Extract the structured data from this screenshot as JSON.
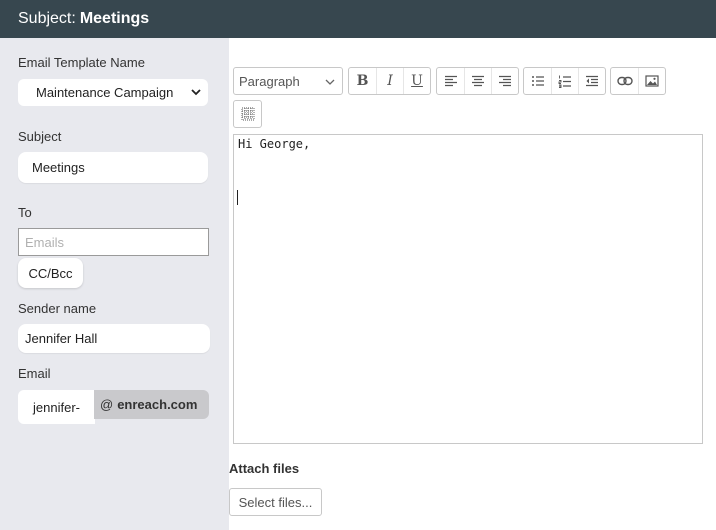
{
  "header": {
    "prefix": "Subject:",
    "subject": "Meetings"
  },
  "sidebar": {
    "template_label": "Email Template Name",
    "template_value": "Maintenance Campaign",
    "subject_label": "Subject",
    "subject_value": "Meetings",
    "to_label": "To",
    "to_placeholder": "Emails",
    "ccbcc_label": "CC/Bcc",
    "sender_label": "Sender name",
    "sender_value": "Jennifer Hall",
    "email_label": "Email",
    "email_local": "jennifer-",
    "email_at": "@",
    "email_domain": "enreach.com"
  },
  "toolbar": {
    "format_value": "Paragraph",
    "bold_icon": "B",
    "italic_icon": "I",
    "underline_icon": "U"
  },
  "editor": {
    "content": "Hi George,"
  },
  "attachments": {
    "label": "Attach files",
    "button_label": "Select files..."
  },
  "colors": {
    "header_bg": "#37474f",
    "sidebar_bg": "#e8e9ee",
    "domain_bg": "#c9c9cc"
  }
}
